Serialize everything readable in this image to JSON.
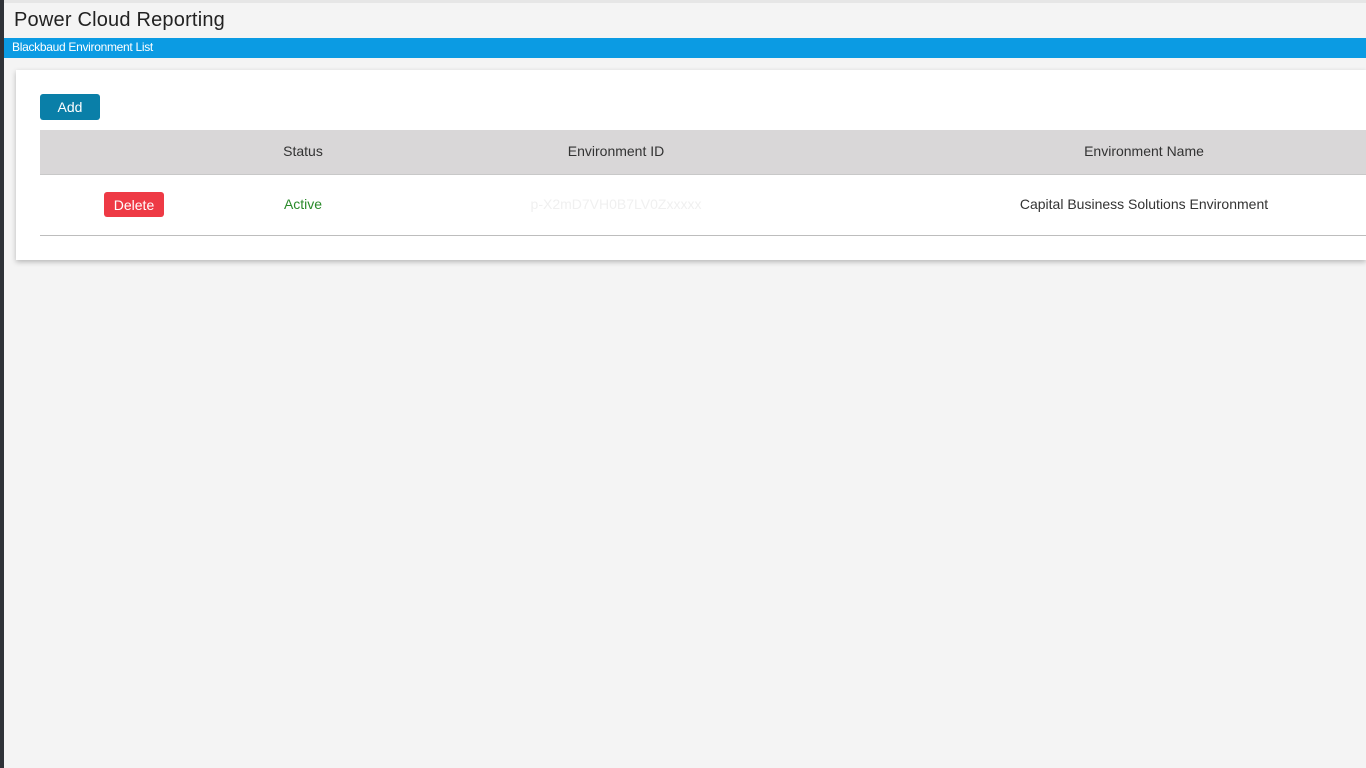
{
  "app": {
    "title": "Power Cloud Reporting"
  },
  "subbar": {
    "label": "Blackbaud Environment List"
  },
  "toolbar": {
    "add_label": "Add"
  },
  "table": {
    "columns": [
      "Status",
      "Environment ID",
      "Environment Name"
    ],
    "rows": [
      {
        "delete_label": "Delete",
        "status": "Active",
        "environment_id": "p-X2mD7VH0B7LV0Zxxxxx",
        "environment_name": "Capital Business Solutions Environment"
      }
    ]
  },
  "colors": {
    "accent_bar": "#0b9be3",
    "add_button": "#0a7fa8",
    "delete_button": "#ee3a45",
    "status_active": "#2a8a2a"
  }
}
